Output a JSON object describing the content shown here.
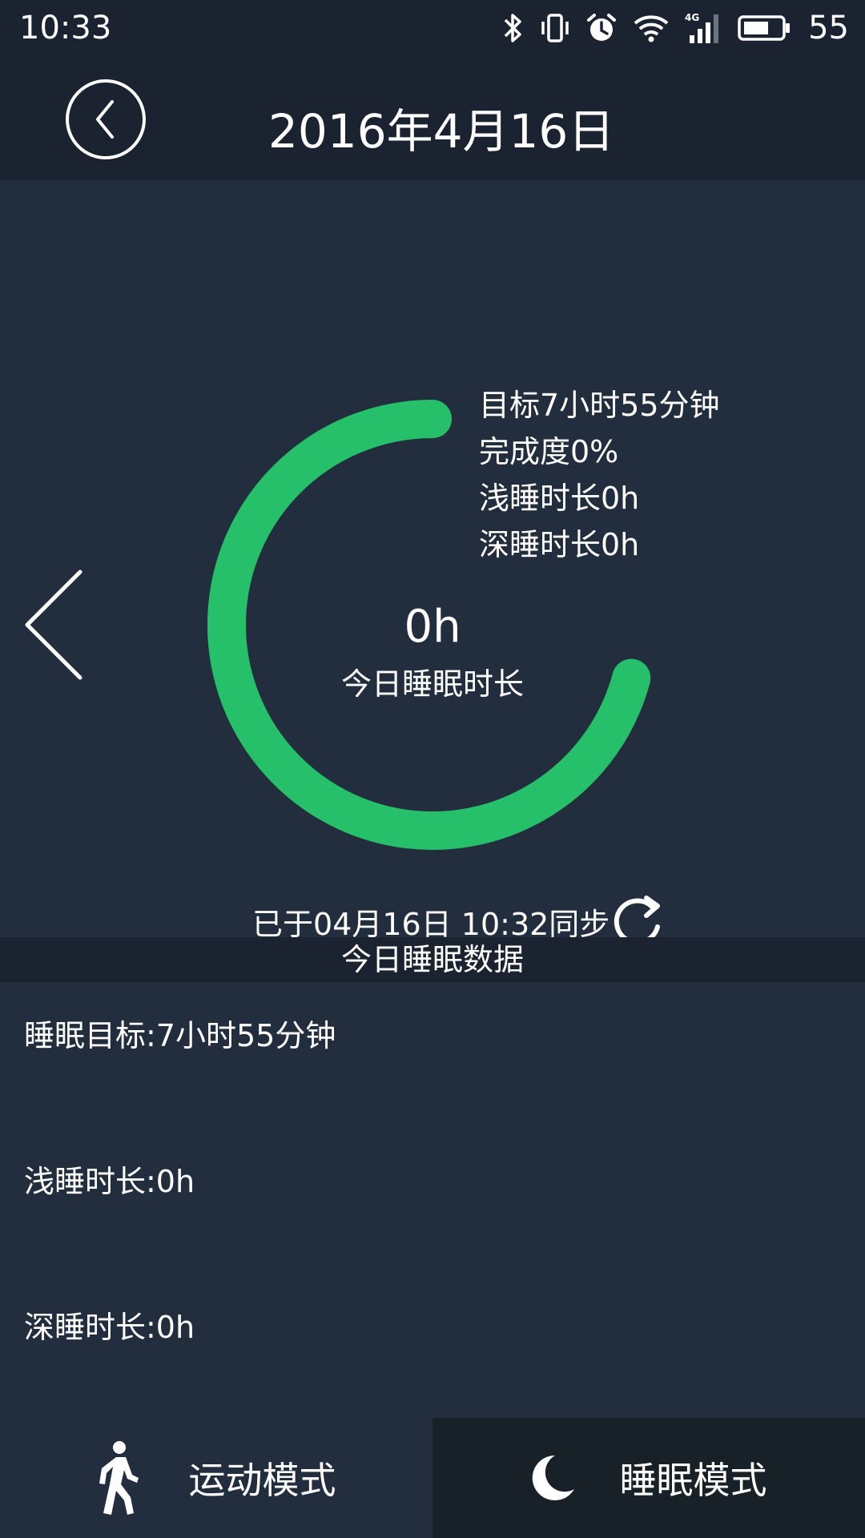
{
  "status_bar": {
    "time": "10:33",
    "battery_level": "55",
    "icons": [
      "bluetooth-icon",
      "vibrate-icon",
      "alarm-icon",
      "wifi-icon",
      "signal-4g-icon",
      "battery-icon"
    ]
  },
  "header": {
    "title": "2016年4月16日"
  },
  "summary": {
    "goal": "目标7小时55分钟",
    "completion": "完成度0%",
    "light_sleep": "浅睡时长0h",
    "deep_sleep": "深睡时长0h",
    "progress_percent": 0
  },
  "ring": {
    "value": "0h",
    "label": "今日睡眠时长",
    "color": "#26c06b"
  },
  "sync": {
    "text": "已于04月16日 10:32同步"
  },
  "section": {
    "title": "今日睡眠数据"
  },
  "details": {
    "goal": "睡眠目标:7小时55分钟",
    "light_sleep": "浅睡时长:0h",
    "deep_sleep": "深睡时长:0h"
  },
  "nav": {
    "sport_label": "运动模式",
    "sleep_label": "睡眠模式",
    "active": "sleep"
  }
}
